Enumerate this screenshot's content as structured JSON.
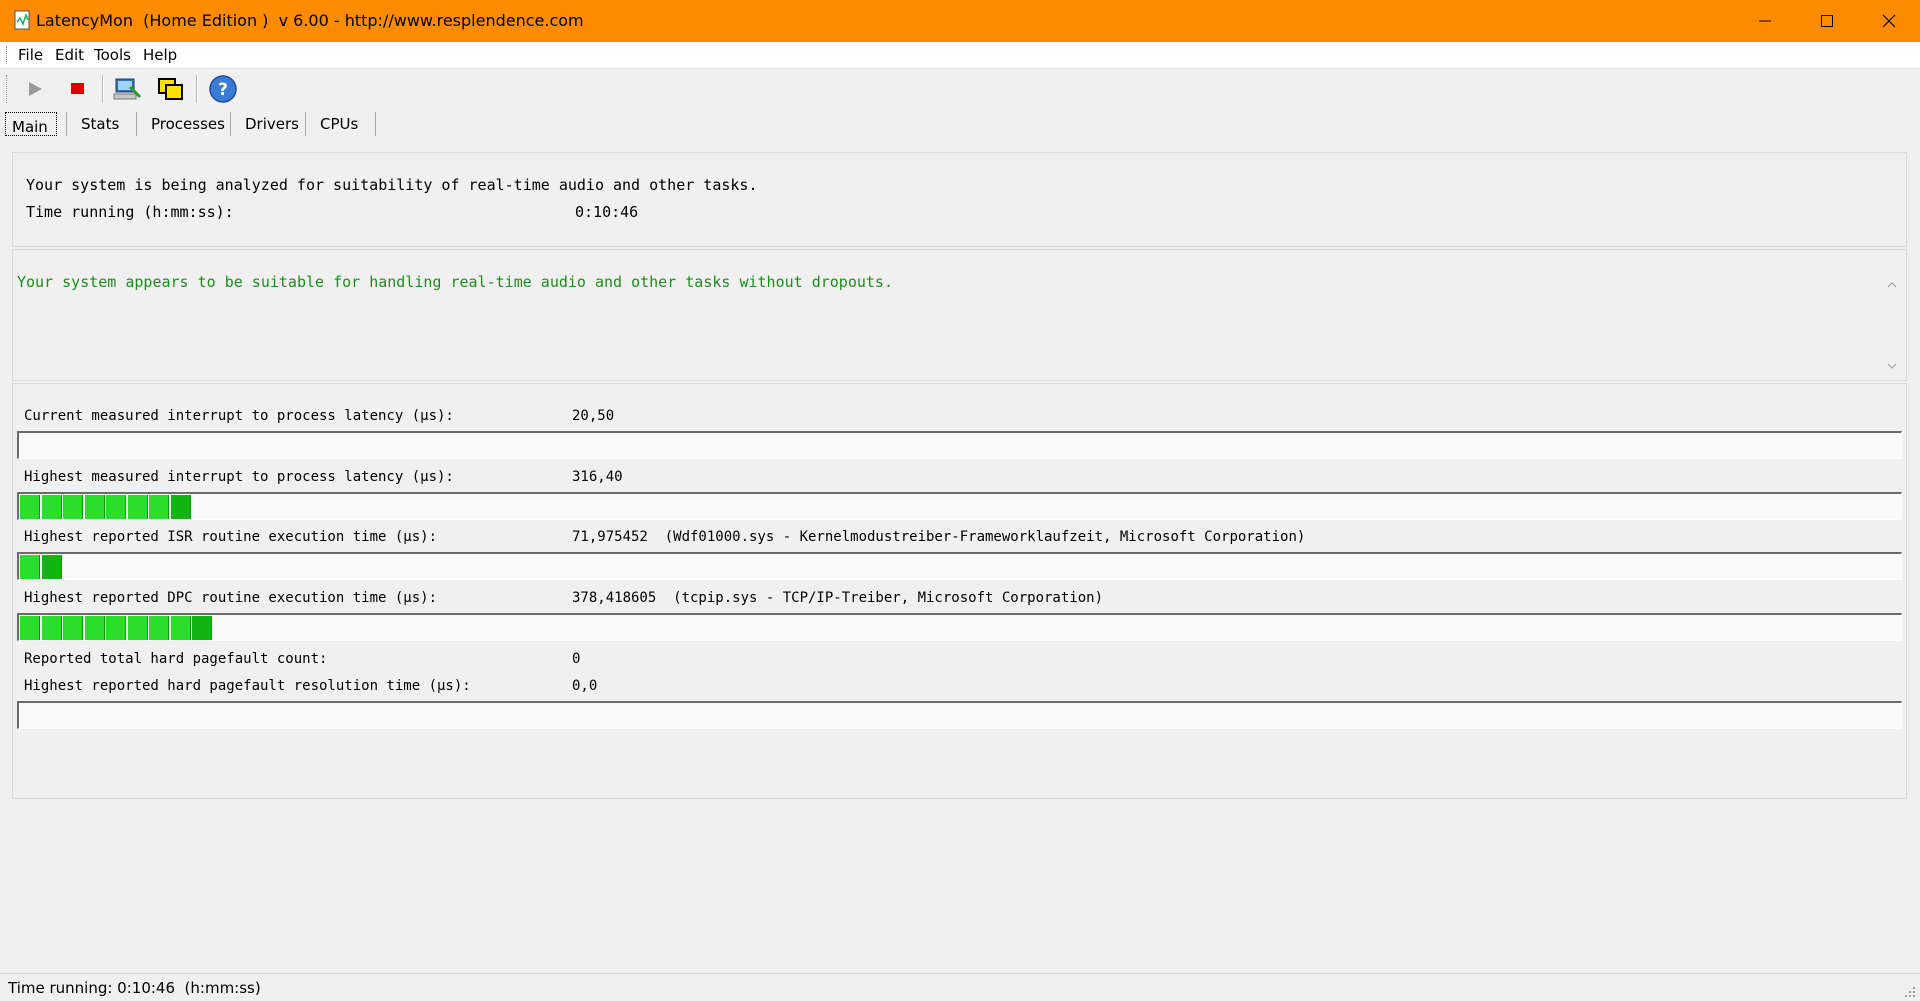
{
  "window": {
    "title": "LatencyMon  (Home Edition )  v 6.00 - http://www.resplendence.com",
    "accent": "#ff8c00"
  },
  "menu": [
    "File",
    "Edit",
    "Tools",
    "Help"
  ],
  "toolbar": {
    "buttons": [
      "play-icon",
      "stop-icon",
      "computer-icon",
      "windows-icon",
      "help-icon"
    ]
  },
  "tabs": [
    "Main",
    "Stats",
    "Processes",
    "Drivers",
    "CPUs"
  ],
  "top_panel": {
    "line1": "Your system is being analyzed for suitability of real-time audio and other tasks.",
    "time_label": "Time running (h:mm:ss):",
    "time_value": "0:10:46"
  },
  "message": {
    "text": "Your system appears to be suitable for handling real-time audio and other tasks without dropouts.",
    "color": "#1a8f1a"
  },
  "stats": [
    {
      "label": "Current measured interrupt to process latency (µs):",
      "value": "20,50",
      "segments": 0
    },
    {
      "label": "Highest measured interrupt to process latency (µs):",
      "value": "316,40",
      "segments": 8
    },
    {
      "label": "Highest reported ISR routine execution time (µs):",
      "value": "71,975452  (Wdf01000.sys - Kernelmodustreiber-Frameworklaufzeit, Microsoft Corporation)",
      "segments": 2
    },
    {
      "label": "Highest reported DPC routine execution time (µs):",
      "value": "378,418605  (tcpip.sys - TCP/IP-Treiber, Microsoft Corporation)",
      "segments": 9
    },
    {
      "label": "Reported total hard pagefault count:",
      "value": "0"
    },
    {
      "label": "Highest reported hard pagefault resolution time (µs):",
      "value": "0,0",
      "segments": 0
    }
  ],
  "status": {
    "text": "Time running: 0:10:46  (h:mm:ss)"
  }
}
